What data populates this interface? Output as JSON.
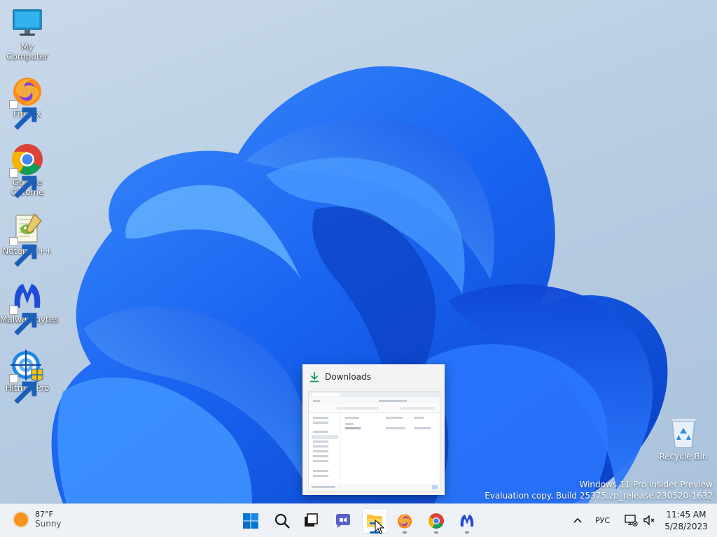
{
  "desktop": {
    "icons": [
      {
        "label": "My Computer"
      },
      {
        "label": "Firefox"
      },
      {
        "label": "Google Chrome"
      },
      {
        "label": "Notepad++"
      },
      {
        "label": "Malwarebytes"
      },
      {
        "label": "HitmanPro"
      }
    ],
    "recycle_bin": {
      "label": "Recycle Bin"
    }
  },
  "watermark": {
    "line1": "Windows 11 Pro Insider Preview",
    "line2": "Evaluation copy. Build 25375.zn_release.230520-1632"
  },
  "thumbnail": {
    "title": "Downloads",
    "icon": "download-icon"
  },
  "taskbar": {
    "weather": {
      "temp": "87°F",
      "condition": "Sunny",
      "icon": "sun-icon"
    },
    "pinned": [
      {
        "name": "start",
        "icon": "windows-logo-icon"
      },
      {
        "name": "search",
        "icon": "search-icon"
      },
      {
        "name": "task-view",
        "icon": "task-view-icon"
      },
      {
        "name": "chat",
        "icon": "chat-icon"
      },
      {
        "name": "file-explorer",
        "icon": "folder-icon",
        "active": true
      },
      {
        "name": "firefox",
        "icon": "firefox-icon"
      },
      {
        "name": "chrome",
        "icon": "chrome-icon"
      },
      {
        "name": "malwarebytes",
        "icon": "malwarebytes-icon"
      }
    ],
    "tray": {
      "language": "РУС",
      "time": "11:45 AM",
      "date": "5/28/2023"
    }
  },
  "colors": {
    "accent": "#005fb8",
    "bloom": "#1f6bff",
    "taskbar": "#eef1f6"
  }
}
